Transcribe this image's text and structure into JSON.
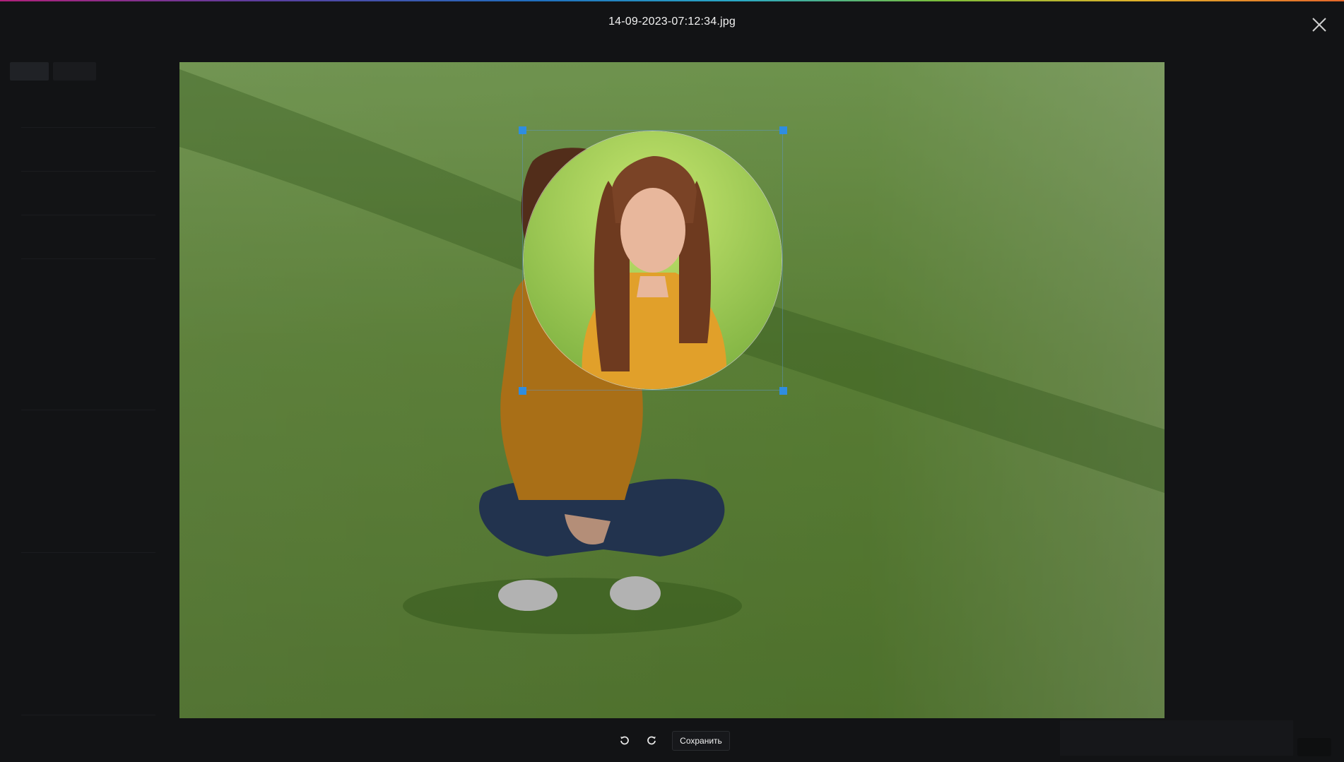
{
  "modal": {
    "title": "14-09-2023-07:12:34.jpg",
    "close_icon": "close-icon"
  },
  "toolbar": {
    "rotate_left_icon": "rotate-ccw-icon",
    "rotate_right_icon": "rotate-cw-icon",
    "save_label": "Сохранить"
  },
  "crop": {
    "shape": "circle",
    "selection_color": "#2f8de0"
  },
  "colors": {
    "background": "#121315",
    "accent": "#2f8de0"
  }
}
